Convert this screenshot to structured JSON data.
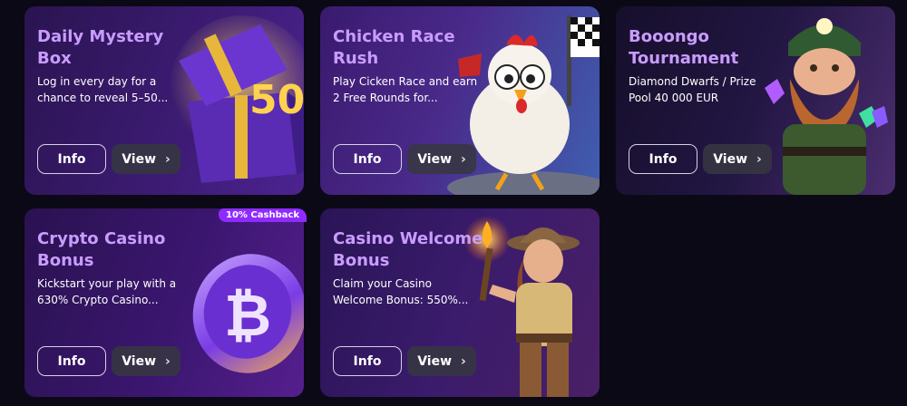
{
  "cards": [
    {
      "title": "Daily Mystery Box",
      "description": "Log in every day for a chance to reveal 5–50...",
      "info_label": "Info",
      "view_label": "View",
      "art": "gift-box-50",
      "art_text": "50"
    },
    {
      "title": "Chicken Race Rush",
      "description": "Play Cicken Race and earn 2 Free Rounds for...",
      "info_label": "Info",
      "view_label": "View",
      "art": "chicken-with-checkered-flag"
    },
    {
      "title": "Booongo Tournament",
      "description": "Diamond Dwarfs / Prize Pool 40 000 EUR",
      "info_label": "Info",
      "view_label": "View",
      "art": "dwarf-miner-with-gems"
    },
    {
      "title": "Crypto Casino Bonus",
      "description": "Kickstart your play with a 630% Crypto Casino...",
      "info_label": "Info",
      "view_label": "View",
      "art": "bitcoin-coin",
      "badge": "10% Cashback"
    },
    {
      "title": "Casino Welcome Bonus",
      "description": "Claim your Casino Welcome Bonus: 550%...",
      "info_label": "Info",
      "view_label": "View",
      "art": "explorer-with-torch"
    }
  ],
  "colors": {
    "background": "#0b0916",
    "title": "#c99cff",
    "badge": "#8f2bff"
  }
}
